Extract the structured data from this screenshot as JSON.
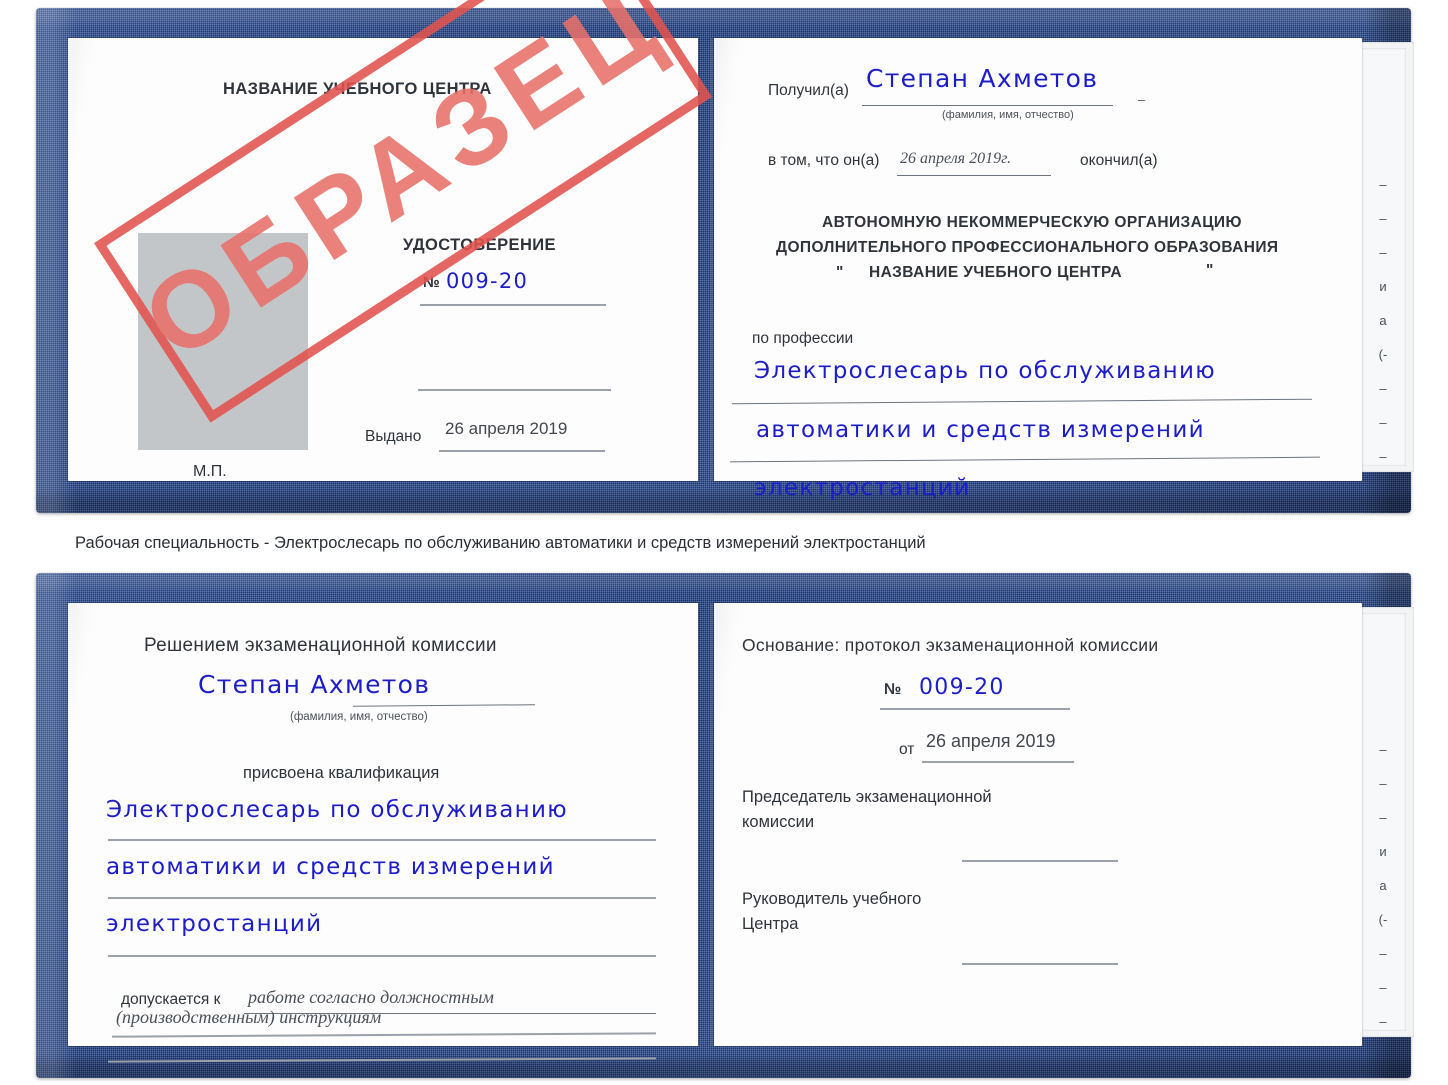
{
  "document": {
    "type": "Удостоверение (образец)",
    "watermark": "ОБРАЗЕЦ",
    "caption": "Рабочая специальность - Электрослесарь по обслуживанию автоматики и средств измерений электростанций"
  },
  "certificate_top": {
    "left_page": {
      "center_name": "НАЗВАНИЕ УЧЕБНОГО ЦЕНТРА",
      "title": "УДОСТОВЕРЕНИЕ",
      "number_label": "№",
      "number_value": "009-20",
      "issued_label": "Выдано",
      "issued_value": "26 апреля 2019",
      "seal_label": "М.П."
    },
    "right_page": {
      "received_label": "Получил(а)",
      "received_value": "Степан Ахметов",
      "fio_hint": "(фамилия, имя, отчество)",
      "that_he_label": "в том, что он(а)",
      "finish_date": "26 апреля 2019г.",
      "finished_label": "окончил(а)",
      "org_line1": "АВТОНОМНУЮ НЕКОММЕРЧЕСКУЮ ОРГАНИЗАЦИЮ",
      "org_line2": "ДОПОЛНИТЕЛЬНОГО ПРОФЕССИОНАЛЬНОГО ОБРАЗОВАНИЯ",
      "org_quote_open": "\"",
      "org_line3": "НАЗВАНИЕ УЧЕБНОГО ЦЕНТРА",
      "org_quote_close": "\"",
      "profession_label": "по профессии",
      "profession_line1": "Электрослесарь по обслуживанию",
      "profession_line2": "автоматики и средств измерений",
      "profession_line3": "электростанций",
      "edge_glyphs": [
        "–",
        "–",
        "–",
        "и",
        "а",
        "(-",
        "–",
        "–",
        "–",
        "–"
      ]
    }
  },
  "certificate_bottom": {
    "left_page": {
      "heading": "Решением экзаменационной комиссии",
      "name_value": "Степан Ахметов",
      "fio_hint": "(фамилия, имя, отчество)",
      "qualification_label": "присвоена квалификация",
      "qualification_line1": "Электрослесарь по обслуживанию",
      "qualification_line2": "автоматики и средств измерений",
      "qualification_line3": "электростанций",
      "admitted_label": "допускается к",
      "admitted_line1": "работе согласно должностным",
      "admitted_line2": "(производственным) инструкциям"
    },
    "right_page": {
      "basis_label": "Основание: протокол экзаменационной комиссии",
      "number_label": "№",
      "number_value": "009-20",
      "date_label": "от",
      "date_value": "26 апреля 2019",
      "chairman_line1": "Председатель экзаменационной",
      "chairman_line2": "комиссии",
      "head_line1": "Руководитель учебного",
      "head_line2": "Центра",
      "edge_glyphs": [
        "–",
        "–",
        "–",
        "и",
        "а",
        "(-",
        "–",
        "–",
        "–",
        "–"
      ]
    }
  },
  "colors": {
    "cover_blue": "#27478c",
    "handwriting_blue": "#1d1dc8",
    "stamp_red": "#e2534e",
    "rule_gray": "#9aa1a9",
    "photo_gray": "#c3c6c8",
    "text_dark": "#3a3f47"
  }
}
